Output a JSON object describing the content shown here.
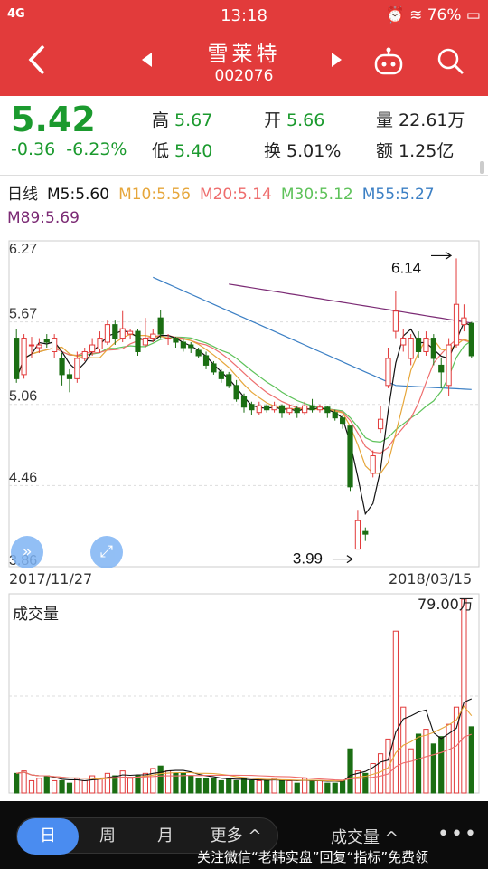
{
  "status": {
    "signal": "4G",
    "time": "13:18",
    "battery": "76%"
  },
  "header": {
    "name": "雪莱特",
    "code": "002076",
    "back_icon": "chevron-left-icon",
    "prev_icon": "triangle-left-icon",
    "next_icon": "triangle-right-icon"
  },
  "quote": {
    "price": "5.42",
    "change": "-0.36",
    "change_pct": "-6.23%",
    "high_label": "高",
    "high": "5.67",
    "low_label": "低",
    "low": "5.40",
    "open_label": "开",
    "open": "5.66",
    "turnover_label": "换",
    "turnover": "5.01%",
    "volume_label": "量",
    "volume": "22.61万",
    "amount_label": "额",
    "amount": "1.25亿"
  },
  "ma": {
    "period": "日线",
    "m5": "M5:5.60",
    "m10": "M10:5.56",
    "m20": "M20:5.14",
    "m30": "M30:5.12",
    "m55": "M55:5.27",
    "m89": "M89:5.69"
  },
  "colors": {
    "up": "#e23b3b",
    "down": "#1b6e13",
    "m5": "#111111",
    "m10": "#e6a63a",
    "m20": "#ee6d6d",
    "m30": "#5ec25a",
    "m55": "#3b7fc4",
    "m89": "#7b2a74"
  },
  "chart_data": {
    "type": "candlestick",
    "y_ticks": [
      "6.27",
      "5.67",
      "5.06",
      "4.46",
      "3.86"
    ],
    "ylim": [
      3.86,
      6.27
    ],
    "start_date": "2017/11/27",
    "end_date": "2018/03/15",
    "high_annotation": "6.14",
    "low_annotation": "3.99",
    "candles": [
      [
        5.55,
        5.25,
        5.62,
        5.22
      ],
      [
        5.28,
        5.55,
        5.58,
        5.25
      ],
      [
        5.5,
        5.5,
        5.56,
        5.4
      ],
      [
        5.48,
        5.5,
        5.55,
        5.44
      ],
      [
        5.54,
        5.52,
        5.58,
        5.48
      ],
      [
        5.45,
        5.55,
        5.58,
        5.4
      ],
      [
        5.4,
        5.28,
        5.44,
        5.2
      ],
      [
        5.28,
        5.25,
        5.32,
        5.15
      ],
      [
        5.25,
        5.4,
        5.45,
        5.22
      ],
      [
        5.4,
        5.45,
        5.48,
        5.38
      ],
      [
        5.45,
        5.5,
        5.55,
        5.42
      ],
      [
        5.47,
        5.55,
        5.6,
        5.44
      ],
      [
        5.52,
        5.65,
        5.68,
        5.5
      ],
      [
        5.65,
        5.55,
        5.68,
        5.5
      ],
      [
        5.55,
        5.62,
        5.75,
        5.52
      ],
      [
        5.58,
        5.6,
        5.62,
        5.54
      ],
      [
        5.6,
        5.45,
        5.62,
        5.42
      ],
      [
        5.5,
        5.55,
        5.7,
        5.48
      ],
      [
        5.55,
        5.58,
        5.62,
        5.52
      ],
      [
        5.7,
        5.58,
        5.76,
        5.55
      ],
      [
        5.55,
        5.55,
        5.58,
        5.5
      ],
      [
        5.55,
        5.52,
        5.56,
        5.48
      ],
      [
        5.52,
        5.48,
        5.54,
        5.45
      ],
      [
        5.5,
        5.48,
        5.52,
        5.44
      ],
      [
        5.46,
        5.42,
        5.48,
        5.4
      ],
      [
        5.42,
        5.35,
        5.45,
        5.32
      ],
      [
        5.36,
        5.3,
        5.38,
        5.28
      ],
      [
        5.3,
        5.25,
        5.32,
        5.22
      ],
      [
        5.28,
        5.2,
        5.3,
        5.18
      ],
      [
        5.2,
        5.1,
        5.24,
        5.08
      ],
      [
        5.12,
        5.04,
        5.14,
        5.0
      ],
      [
        5.06,
        5.02,
        5.08,
        4.98
      ],
      [
        5.0,
        5.05,
        5.08,
        4.98
      ],
      [
        5.05,
        5.02,
        5.06,
        5.0
      ],
      [
        5.02,
        5.05,
        5.08,
        5.0
      ],
      [
        5.05,
        5.0,
        5.06,
        4.96
      ],
      [
        5.0,
        5.03,
        5.06,
        4.98
      ],
      [
        5.03,
        5.0,
        5.05,
        4.96
      ],
      [
        5.0,
        5.05,
        5.08,
        4.98
      ],
      [
        5.05,
        5.02,
        5.1,
        5.0
      ],
      [
        5.02,
        5.04,
        5.06,
        5.0
      ],
      [
        5.04,
        5.0,
        5.05,
        4.96
      ],
      [
        5.0,
        4.96,
        5.02,
        4.94
      ],
      [
        4.96,
        4.92,
        4.98,
        4.88
      ],
      [
        4.9,
        4.45,
        4.9,
        4.42
      ],
      [
        3.99,
        4.2,
        4.28,
        3.99
      ],
      [
        4.12,
        4.1,
        4.15,
        4.05
      ],
      [
        4.55,
        4.68,
        4.72,
        4.52
      ],
      [
        4.88,
        4.95,
        5.05,
        4.85
      ],
      [
        5.2,
        5.4,
        5.48,
        5.18
      ],
      [
        5.6,
        5.75,
        5.9,
        5.55
      ],
      [
        5.5,
        5.55,
        5.62,
        5.45
      ],
      [
        5.4,
        5.55,
        5.58,
        5.35
      ],
      [
        5.55,
        5.45,
        5.6,
        5.4
      ],
      [
        5.45,
        5.55,
        5.6,
        5.42
      ],
      [
        5.55,
        5.4,
        5.58,
        5.35
      ],
      [
        5.35,
        5.3,
        5.4,
        5.18
      ],
      [
        5.2,
        5.5,
        5.55,
        5.12
      ],
      [
        5.5,
        5.8,
        6.14,
        5.48
      ],
      [
        5.65,
        5.7,
        5.8,
        5.6
      ],
      [
        5.66,
        5.42,
        5.67,
        5.4
      ]
    ],
    "volume_label": "成交量",
    "volume_max": "79.00万",
    "volumes": [
      8,
      9,
      5,
      6,
      7,
      5,
      5,
      4,
      6,
      5,
      7,
      6,
      8,
      7,
      9,
      6,
      7,
      8,
      10,
      11,
      9,
      8,
      8,
      7,
      6,
      6,
      6,
      5,
      6,
      5,
      6,
      5,
      5,
      5,
      6,
      5,
      5,
      4,
      6,
      5,
      5,
      4,
      4,
      5,
      18,
      9,
      8,
      12,
      16,
      22,
      66,
      35,
      18,
      24,
      26,
      20,
      23,
      28,
      35,
      79,
      27
    ]
  },
  "bottom": {
    "tabs": [
      "日",
      "周",
      "月",
      "更多 ^"
    ],
    "volume_selector": "成交量 ^",
    "more_icon": "more-dots-icon",
    "watermark": "关注微信“老韩实盘”回复“指标”免费领"
  }
}
